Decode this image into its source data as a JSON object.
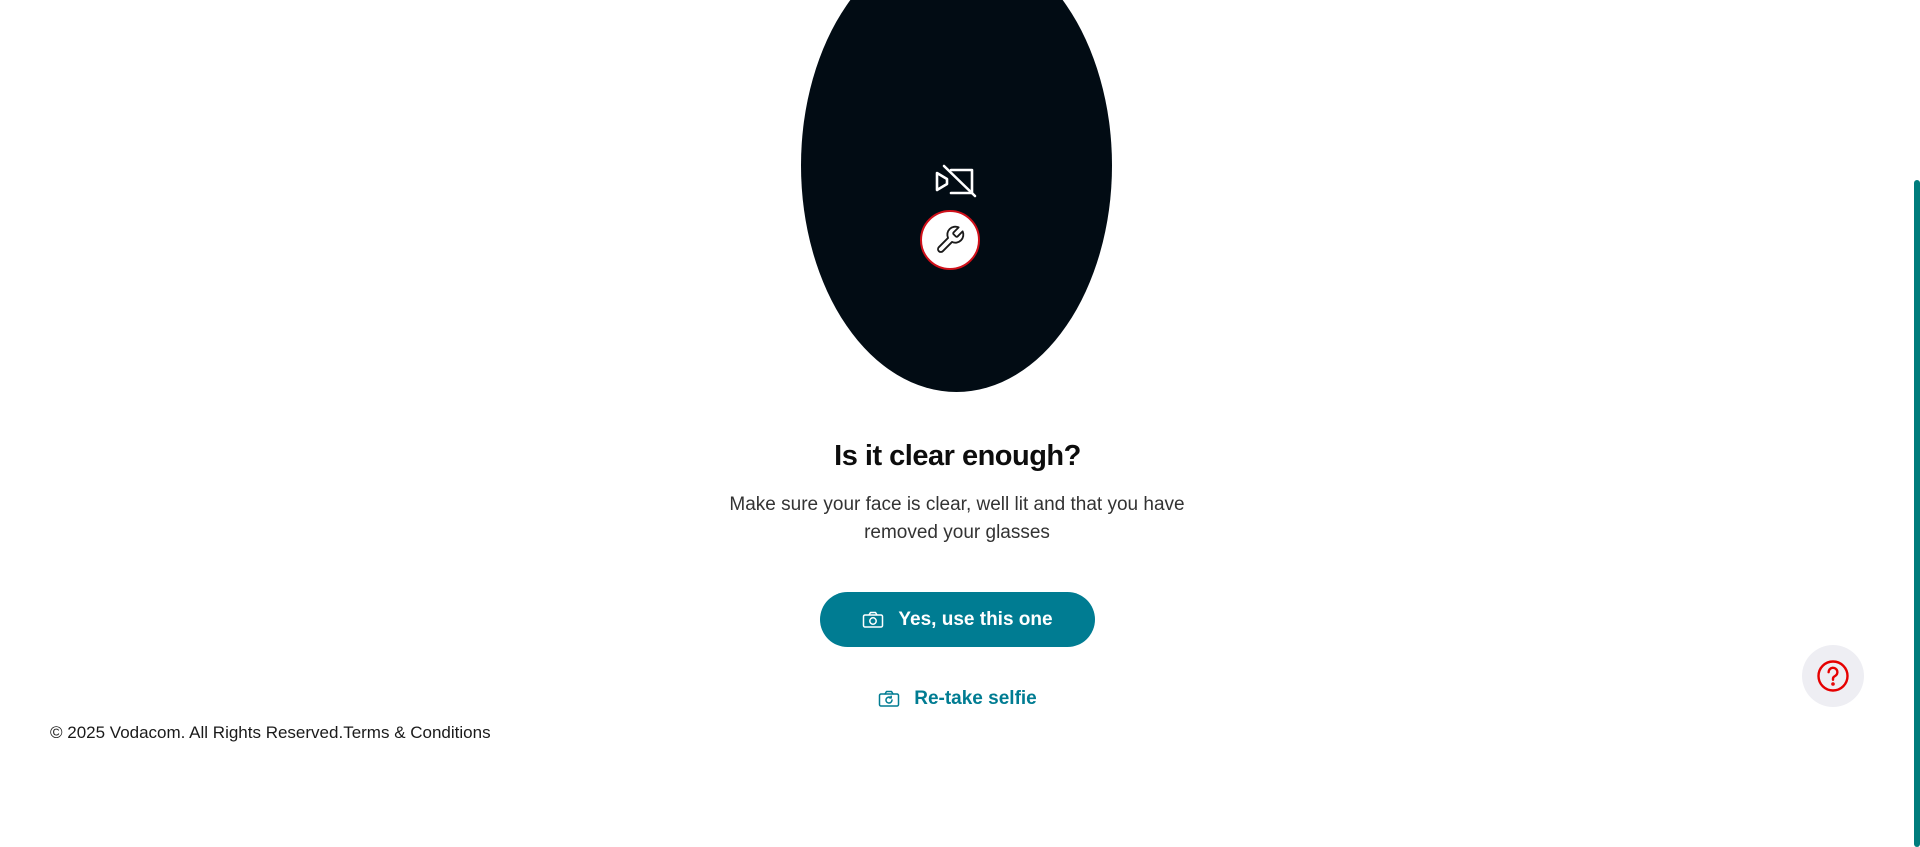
{
  "preview": {
    "camera_icon": "camera-off-icon",
    "tool_icon": "wrench-icon"
  },
  "main": {
    "title": "Is it clear enough?",
    "subtitle": "Make sure your face is clear, well lit and that you have removed your glasses"
  },
  "actions": {
    "confirm_label": "Yes, use this one",
    "confirm_icon": "camera-icon",
    "retake_label": "Re-take selfie",
    "retake_icon": "camera-retake-icon"
  },
  "footer": {
    "copyright": "© 2025 Vodacom. All Rights Reserved.",
    "terms_link": "Terms & Conditions"
  },
  "help": {
    "icon": "help-icon"
  },
  "colors": {
    "brand": "#007c92",
    "accent_red": "#d0101a",
    "preview_bg": "#020c14",
    "help_bg": "#eeeef3"
  }
}
